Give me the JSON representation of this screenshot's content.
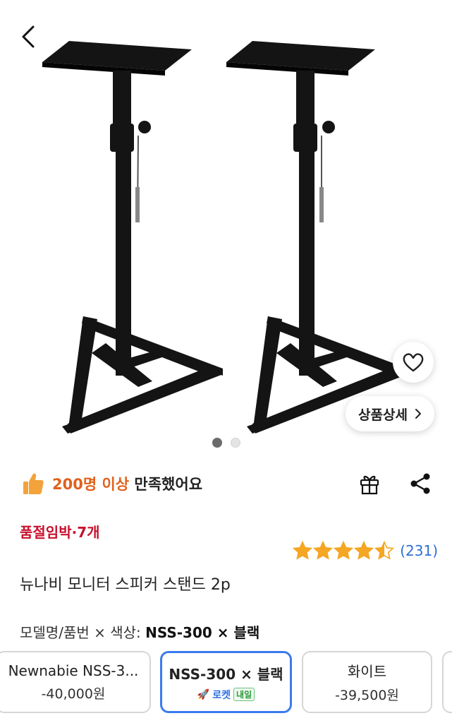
{
  "hero": {
    "wishlist_icon": "heart-outline-icon",
    "detail_button_label": "상품상세",
    "carousel_count": 2,
    "carousel_active_index": 0
  },
  "satisfaction": {
    "highlight": "200명 이상",
    "rest": "만족했어요",
    "icon": "thumbs-up-icon"
  },
  "actions": {
    "gift_icon": "gift-icon",
    "share_icon": "share-icon"
  },
  "stock_notice": "품절임박·7개",
  "rating": {
    "stars": 4.5,
    "max": 5,
    "count_text": "(231)"
  },
  "product_title": "뉴나비 모니터 스피커 스탠드 2p",
  "option": {
    "label_prefix": "모델명/품번 × 색상:",
    "selected_value": "NSS-300 × 블랙",
    "items": [
      {
        "name": "Newnabie NSS-3...",
        "price": "-40,000원",
        "selected": false
      },
      {
        "name": "NSS-300 × 블랙",
        "badge": "로켓",
        "badge_extra": "내일",
        "selected": true
      },
      {
        "name": "화이트",
        "price": "-39,500원",
        "selected": false
      }
    ]
  },
  "colors": {
    "accent_blue": "#3a7bf0",
    "orange": "#e0611c",
    "stock_red": "#c8102e",
    "star": "#f5a623",
    "rating_blue": "#2d6fd3"
  }
}
